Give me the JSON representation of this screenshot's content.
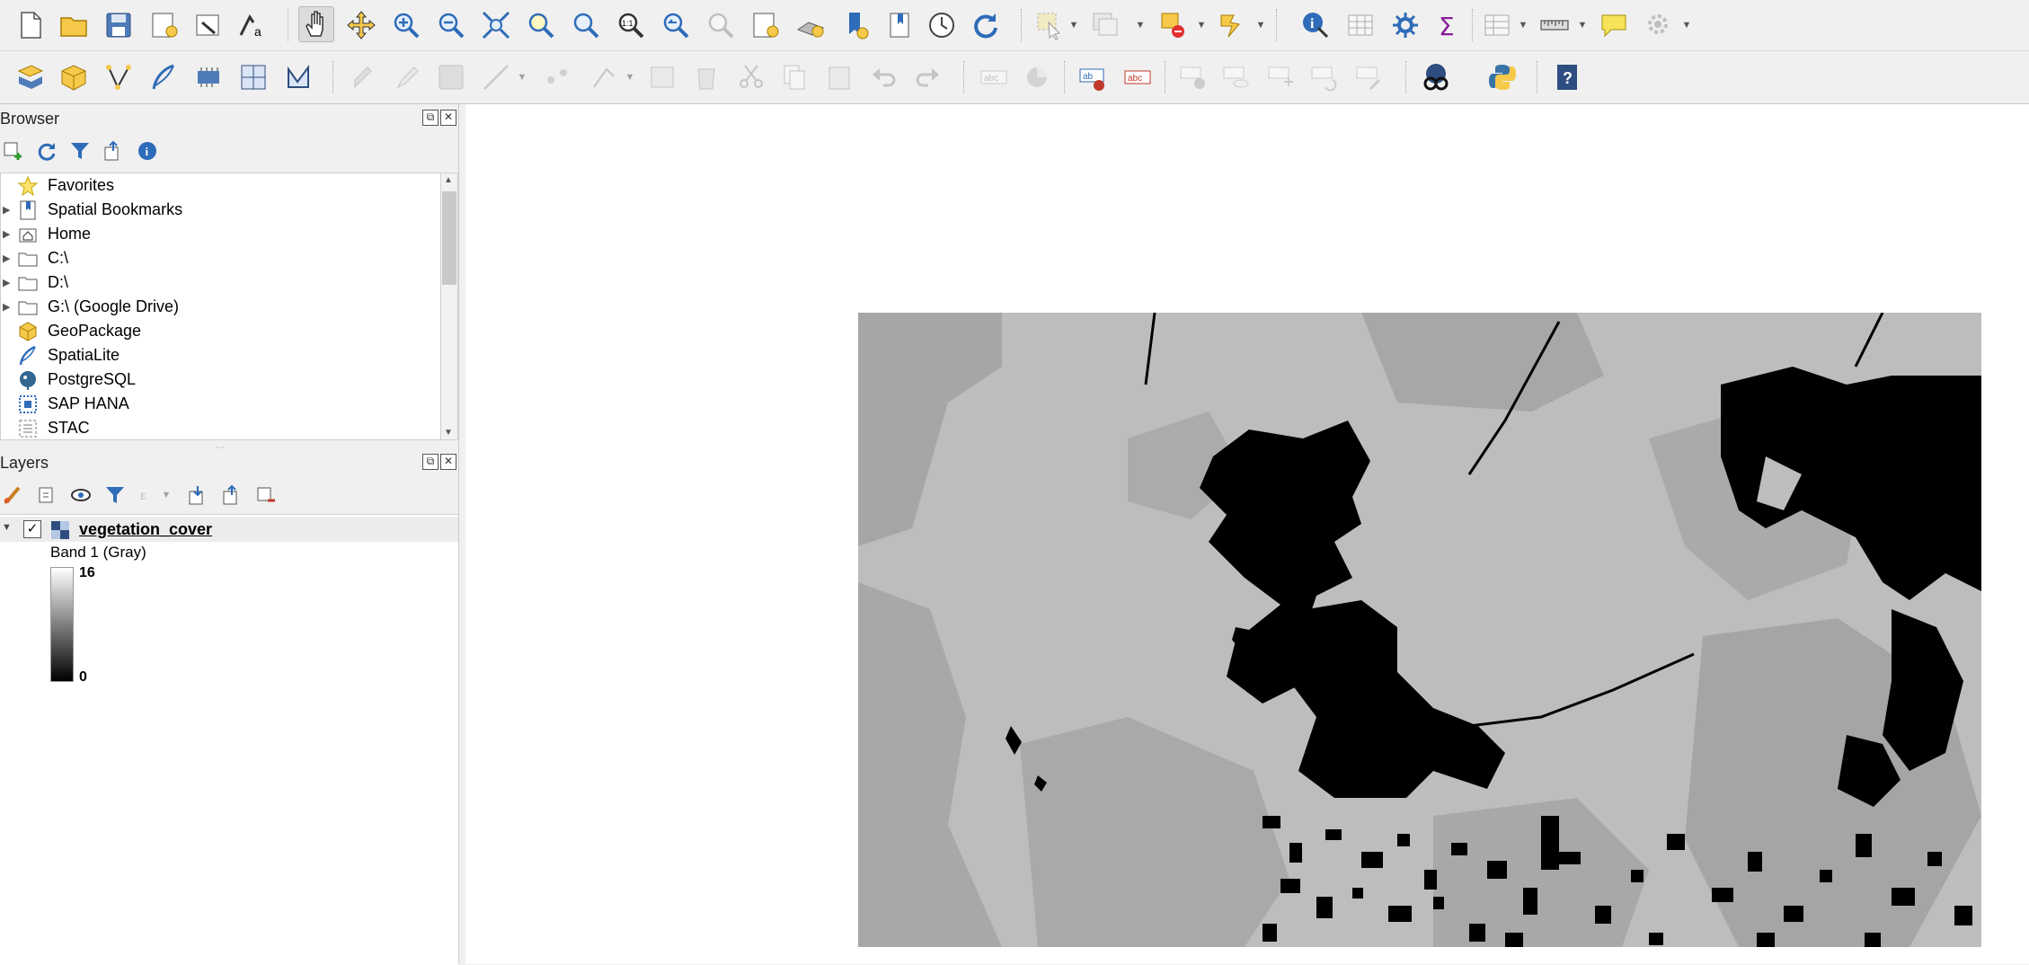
{
  "toolbar_row1": [
    "new-project",
    "open-project",
    "save-project",
    "new-print-layout",
    "show-layout-manager",
    "style-manager",
    "pan-map",
    "pan-to-selection",
    "zoom-in",
    "zoom-out",
    "zoom-full",
    "zoom-to-selection",
    "zoom-to-layer",
    "zoom-native-resolution",
    "zoom-last",
    "zoom-next",
    "new-map-view",
    "new-3d-map-view",
    "new-spatial-bookmark",
    "show-spatial-bookmarks",
    "temporal-controller",
    "refresh",
    "select-features",
    "deselect",
    "select-by-location",
    "select-by-expression",
    "identify-features",
    "attribute-table",
    "processing-toolbox",
    "statistical-summary",
    "open-field-calculator",
    "measure-line",
    "map-tips",
    "settings"
  ],
  "toolbar_row2": [
    "data-source-manager",
    "new-geopackage-layer",
    "vertex-tool",
    "new-spatialite-layer",
    "new-virtual-layer",
    "new-temporary-scratch-layer",
    "new-gpx-layer",
    "current-edits",
    "toggle-editing",
    "save-layer-edits",
    "digitize",
    "add-feature",
    "vertex-tool-all",
    "modify-attributes",
    "delete-selected",
    "cut-features",
    "copy-features",
    "paste-features",
    "undo",
    "redo",
    "label-tool",
    "diagram-options",
    "layer-labeling",
    "annotation-labels",
    "pin-labels",
    "show-hide-labels",
    "move-label",
    "rotate-label",
    "change-label",
    "metasearch",
    "python-console",
    "help"
  ],
  "browser": {
    "title": "Browser",
    "items": [
      {
        "label": "Favorites",
        "icon": "star-icon",
        "expandable": false
      },
      {
        "label": "Spatial Bookmarks",
        "icon": "bookmark-icon",
        "expandable": true
      },
      {
        "label": "Home",
        "icon": "home-icon",
        "expandable": true
      },
      {
        "label": "C:\\",
        "icon": "folder-icon",
        "expandable": true
      },
      {
        "label": "D:\\",
        "icon": "folder-icon",
        "expandable": true
      },
      {
        "label": "G:\\ (Google Drive)",
        "icon": "folder-icon",
        "expandable": true
      },
      {
        "label": "GeoPackage",
        "icon": "geopackage-icon",
        "expandable": false
      },
      {
        "label": "SpatiaLite",
        "icon": "spatialite-icon",
        "expandable": false
      },
      {
        "label": "PostgreSQL",
        "icon": "postgresql-icon",
        "expandable": false
      },
      {
        "label": "SAP HANA",
        "icon": "sap-hana-icon",
        "expandable": false
      },
      {
        "label": "STAC",
        "icon": "stac-icon",
        "expandable": false
      }
    ]
  },
  "layers": {
    "title": "Layers",
    "layer": {
      "name": "vegetation_cover",
      "visible": true,
      "band": "Band 1 (Gray)",
      "max": "16",
      "min": "0"
    }
  },
  "colors": {
    "ui_bg": "#f0f0f0",
    "raster_light": "#bdbdbd",
    "raster_mid": "#a3a3a3",
    "raster_dark": "#000000"
  }
}
